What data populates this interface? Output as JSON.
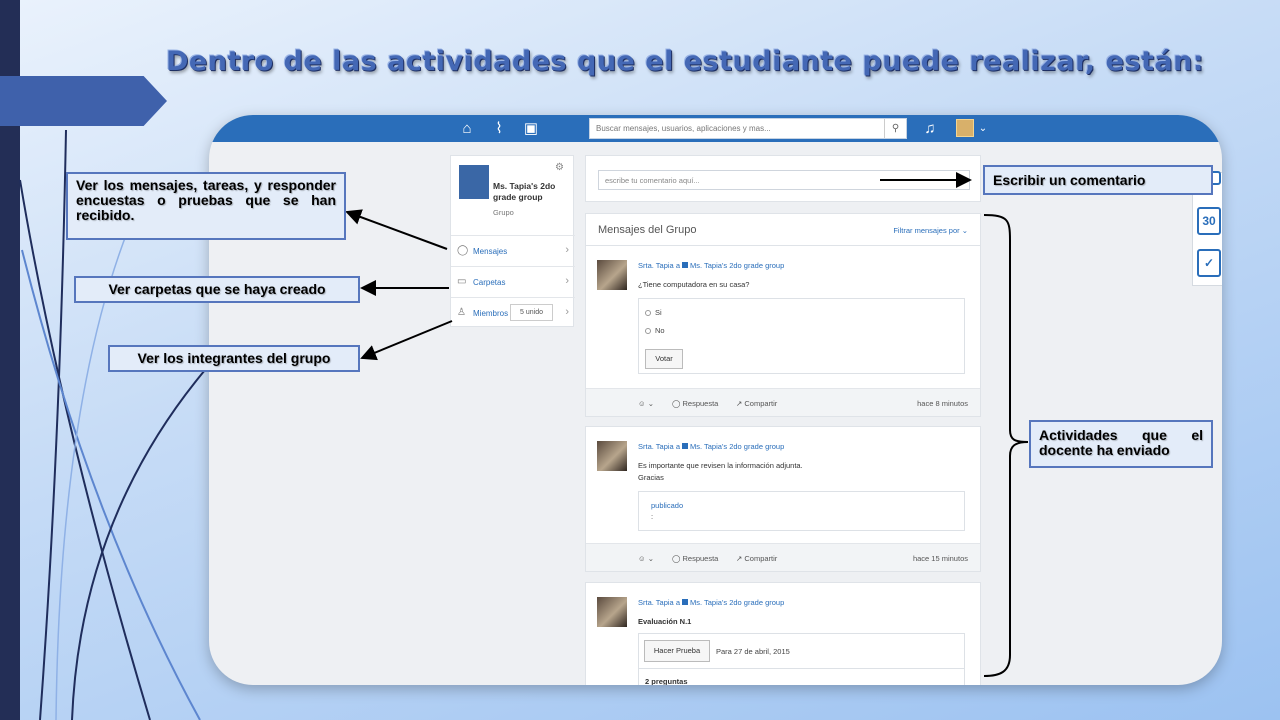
{
  "slide": {
    "title": "Dentro de las actividades que el estudiante puede realizar, están:"
  },
  "colors": {
    "topbar": "#2a6eba",
    "accent": "#2a6eba",
    "callout_border": "#5676bd",
    "title": "#4468b5",
    "left_strip": "#232e56"
  },
  "topbar": {
    "icons": [
      "home-icon",
      "activity-icon",
      "backpack-icon"
    ],
    "search_placeholder": "Buscar mensajes, usuarios, aplicaciones y mas...",
    "bell_icon": "bell-icon"
  },
  "group": {
    "name": "Ms. Tapia's 2do grade group",
    "subtitle": "Grupo",
    "menu": [
      {
        "label": "Mensajes",
        "icon": "chat-icon"
      },
      {
        "label": "Carpetas",
        "icon": "folder-icon"
      },
      {
        "label": "Miembros",
        "icon": "members-icon",
        "count": "5 unido"
      }
    ]
  },
  "comment": {
    "placeholder": "escribe tu comentario aquí..."
  },
  "messages": {
    "title": "Mensajes del Grupo",
    "filter": "Filtrar mensajes por",
    "author": "Srta. Tapia",
    "to_word": "a",
    "group": "Ms. Tapia's 2do grade group",
    "reply": "Respuesta",
    "share": "Compartir",
    "posts": [
      {
        "text": "¿Tiene computadora en su casa?",
        "options": [
          "Si",
          "No"
        ],
        "button": "Votar",
        "time": "hace 8 minutos"
      },
      {
        "line1": "Es importante que revisen la información adjunta.",
        "line2": "Gracias",
        "attachment": "publicado",
        "attachment_sub": ":",
        "time": "hace 15 minutos"
      },
      {
        "title": "Evaluación N.1",
        "button": "Hacer Prueba",
        "due": "Para 27 de abril, 2015",
        "questions": "2 preguntas"
      }
    ]
  },
  "side_icons": {
    "calendar_number": "30"
  },
  "annotations": {
    "messages": "Ver los mensajes, tareas, y responder encuestas o pruebas que se han recibido.",
    "folders": "Ver carpetas que se haya creado",
    "members": "Ver los integrantes del grupo",
    "comment": "Escribir un comentario",
    "activities": "Actividades que el docente ha enviado"
  }
}
